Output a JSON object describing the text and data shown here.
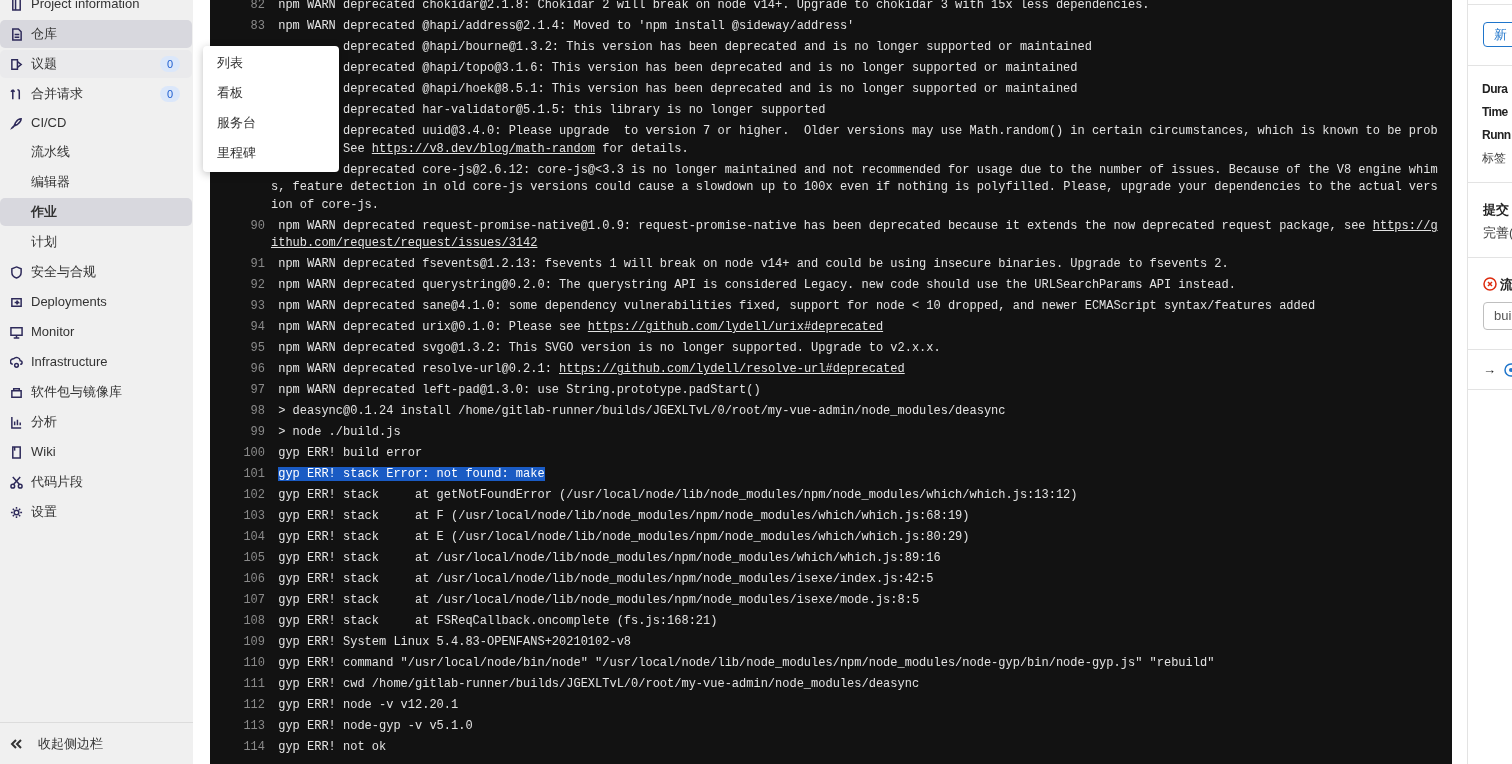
{
  "sidebar": {
    "items": [
      {
        "label": "Project information",
        "selected": false
      },
      {
        "label": "仓库",
        "selected": true
      },
      {
        "label": "议题",
        "selected": false,
        "badge": "0",
        "flyout": [
          {
            "label": "列表"
          },
          {
            "label": "看板"
          },
          {
            "label": "服务台"
          },
          {
            "label": "里程碑"
          }
        ]
      },
      {
        "label": "合并请求",
        "selected": false,
        "badge": "0"
      },
      {
        "label": "CI/CD",
        "selected": false,
        "children": [
          {
            "label": "流水线",
            "selected": false
          },
          {
            "label": "编辑器",
            "selected": false
          },
          {
            "label": "作业",
            "selected": true
          },
          {
            "label": "计划",
            "selected": false
          }
        ]
      },
      {
        "label": "安全与合规",
        "selected": false
      },
      {
        "label": "Deployments",
        "selected": false
      },
      {
        "label": "Monitor",
        "selected": false
      },
      {
        "label": "Infrastructure",
        "selected": false
      },
      {
        "label": "软件包与镜像库",
        "selected": false
      },
      {
        "label": "分析",
        "selected": false
      },
      {
        "label": "Wiki",
        "selected": false
      },
      {
        "label": "代码片段",
        "selected": false
      },
      {
        "label": "设置",
        "selected": false
      }
    ],
    "collapse_label": "收起侧边栏"
  },
  "log": [
    {
      "number": "82",
      "rows": [
        {
          "kind": "line",
          "text": "npm WARN deprecated chokidar@2.1.8: Chokidar 2 will break on node v14+. Upgrade to chokidar 3 with 15x less dependencies."
        }
      ]
    },
    {
      "number": "83",
      "rows": [
        {
          "kind": "line",
          "text": "npm WARN deprecated @hapi/address@2.1.4: Moved to 'npm install @sideway/address'"
        }
      ]
    },
    {
      "rows": [
        {
          "kind": "covered",
          "text": "deprecated @hapi/bourne@1.3.2: This version has been deprecated and is no longer supported or maintained"
        }
      ]
    },
    {
      "rows": [
        {
          "kind": "covered",
          "text": "deprecated @hapi/topo@3.1.6: This version has been deprecated and is no longer supported or maintained"
        }
      ]
    },
    {
      "rows": [
        {
          "kind": "covered",
          "text": "deprecated @hapi/hoek@8.5.1: This version has been deprecated and is no longer supported or maintained"
        }
      ]
    },
    {
      "rows": [
        {
          "kind": "covered",
          "text": "deprecated har-validator@5.1.5: this library is no longer supported"
        }
      ]
    },
    {
      "rows": [
        {
          "kind": "covered",
          "text": "deprecated uuid@3.4.0: Please upgrade  to version 7 or higher.  Older versions may use Math.random() in certain circumstances, which is known to be prob"
        },
        {
          "kind": "covered",
          "text": "See ",
          "link": "https://v8.dev/blog/math-random",
          "after": " for details."
        }
      ]
    },
    {
      "rows": [
        {
          "kind": "covered",
          "text": "deprecated core-js@2.6.12: core-js@<3.3 is no longer maintained and not recommended for usage due to the number of issues. Because of the V8 engine whim"
        },
        {
          "kind": "wrap",
          "text": "s, feature detection in old core-js versions could cause a slowdown up to 100x even if nothing is polyfilled. Please, upgrade your dependencies to the actual vers"
        },
        {
          "kind": "wrap",
          "text": "ion of core-js."
        }
      ]
    },
    {
      "number": "90",
      "rows": [
        {
          "kind": "line",
          "text": "npm WARN deprecated request-promise-native@1.0.9: request-promise-native has been deprecated because it extends the now deprecated request package, see ",
          "link": "https://g"
        },
        {
          "kind": "wrap",
          "link": "ithub.com/request/request/issues/3142"
        }
      ]
    },
    {
      "number": "91",
      "rows": [
        {
          "kind": "line",
          "text": "npm WARN deprecated fsevents@1.2.13: fsevents 1 will break on node v14+ and could be using insecure binaries. Upgrade to fsevents 2."
        }
      ]
    },
    {
      "number": "92",
      "rows": [
        {
          "kind": "line",
          "text": "npm WARN deprecated querystring@0.2.0: The querystring API is considered Legacy. new code should use the URLSearchParams API instead."
        }
      ]
    },
    {
      "number": "93",
      "rows": [
        {
          "kind": "line",
          "text": "npm WARN deprecated sane@4.1.0: some dependency vulnerabilities fixed, support for node < 10 dropped, and newer ECMAScript syntax/features added"
        }
      ]
    },
    {
      "number": "94",
      "rows": [
        {
          "kind": "line",
          "text": "npm WARN deprecated urix@0.1.0: Please see ",
          "link": "https://github.com/lydell/urix#deprecated"
        }
      ]
    },
    {
      "number": "95",
      "rows": [
        {
          "kind": "line",
          "text": "npm WARN deprecated svgo@1.3.2: This SVGO version is no longer supported. Upgrade to v2.x.x."
        }
      ]
    },
    {
      "number": "96",
      "rows": [
        {
          "kind": "line",
          "text": "npm WARN deprecated resolve-url@0.2.1: ",
          "link": "https://github.com/lydell/resolve-url#deprecated"
        }
      ]
    },
    {
      "number": "97",
      "rows": [
        {
          "kind": "line",
          "text": "npm WARN deprecated left-pad@1.3.0: use String.prototype.padStart()"
        }
      ]
    },
    {
      "number": "98",
      "rows": [
        {
          "kind": "line",
          "text": "> deasync@0.1.24 install /home/gitlab-runner/builds/JGEXLTvL/0/root/my-vue-admin/node_modules/deasync"
        }
      ]
    },
    {
      "number": "99",
      "rows": [
        {
          "kind": "line",
          "text": "> node ./build.js"
        }
      ]
    },
    {
      "number": "100",
      "rows": [
        {
          "kind": "line",
          "text": "gyp ERR! build error"
        }
      ]
    },
    {
      "number": "101",
      "rows": [
        {
          "kind": "highlighted",
          "text": "gyp ERR! stack Error: not found: make"
        }
      ]
    },
    {
      "number": "102",
      "rows": [
        {
          "kind": "line",
          "text": "gyp ERR! stack     at getNotFoundError (/usr/local/node/lib/node_modules/npm/node_modules/which/which.js:13:12)"
        }
      ]
    },
    {
      "number": "103",
      "rows": [
        {
          "kind": "line",
          "text": "gyp ERR! stack     at F (/usr/local/node/lib/node_modules/npm/node_modules/which/which.js:68:19)"
        }
      ]
    },
    {
      "number": "104",
      "rows": [
        {
          "kind": "line",
          "text": "gyp ERR! stack     at E (/usr/local/node/lib/node_modules/npm/node_modules/which/which.js:80:29)"
        }
      ]
    },
    {
      "number": "105",
      "rows": [
        {
          "kind": "line",
          "text": "gyp ERR! stack     at /usr/local/node/lib/node_modules/npm/node_modules/which/which.js:89:16"
        }
      ]
    },
    {
      "number": "106",
      "rows": [
        {
          "kind": "line",
          "text": "gyp ERR! stack     at /usr/local/node/lib/node_modules/npm/node_modules/isexe/index.js:42:5"
        }
      ]
    },
    {
      "number": "107",
      "rows": [
        {
          "kind": "line",
          "text": "gyp ERR! stack     at /usr/local/node/lib/node_modules/npm/node_modules/isexe/mode.js:8:5"
        }
      ]
    },
    {
      "number": "108",
      "rows": [
        {
          "kind": "line",
          "text": "gyp ERR! stack     at FSReqCallback.oncomplete (fs.js:168:21)"
        }
      ]
    },
    {
      "number": "109",
      "rows": [
        {
          "kind": "line",
          "text": "gyp ERR! System Linux 5.4.83-OPENFANS+20210102-v8"
        }
      ]
    },
    {
      "number": "110",
      "rows": [
        {
          "kind": "line",
          "text": "gyp ERR! command \"/usr/local/node/bin/node\" \"/usr/local/node/lib/node_modules/npm/node_modules/node-gyp/bin/node-gyp.js\" \"rebuild\""
        }
      ]
    },
    {
      "number": "111",
      "rows": [
        {
          "kind": "line",
          "text": "gyp ERR! cwd /home/gitlab-runner/builds/JGEXLTvL/0/root/my-vue-admin/node_modules/deasync"
        }
      ]
    },
    {
      "number": "112",
      "rows": [
        {
          "kind": "line",
          "text": "gyp ERR! node -v v12.20.1"
        }
      ]
    },
    {
      "number": "113",
      "rows": [
        {
          "kind": "line",
          "text": "gyp ERR! node-gyp -v v5.1.0"
        }
      ]
    },
    {
      "number": "114",
      "rows": [
        {
          "kind": "line",
          "text": "gyp ERR! not ok"
        }
      ]
    }
  ],
  "right_panel": {
    "button": "新",
    "details": [
      {
        "kind": "label",
        "text": "Dura"
      },
      {
        "kind": "label",
        "text": "Time"
      },
      {
        "kind": "label",
        "text": "Runn"
      },
      {
        "kind": "plain",
        "text": "标签"
      }
    ],
    "commit": {
      "title": "提交",
      "message": "完善("
    },
    "pipeline": {
      "failed": true,
      "name": "流"
    },
    "stage_select": "bui",
    "job_arrow": "→"
  }
}
